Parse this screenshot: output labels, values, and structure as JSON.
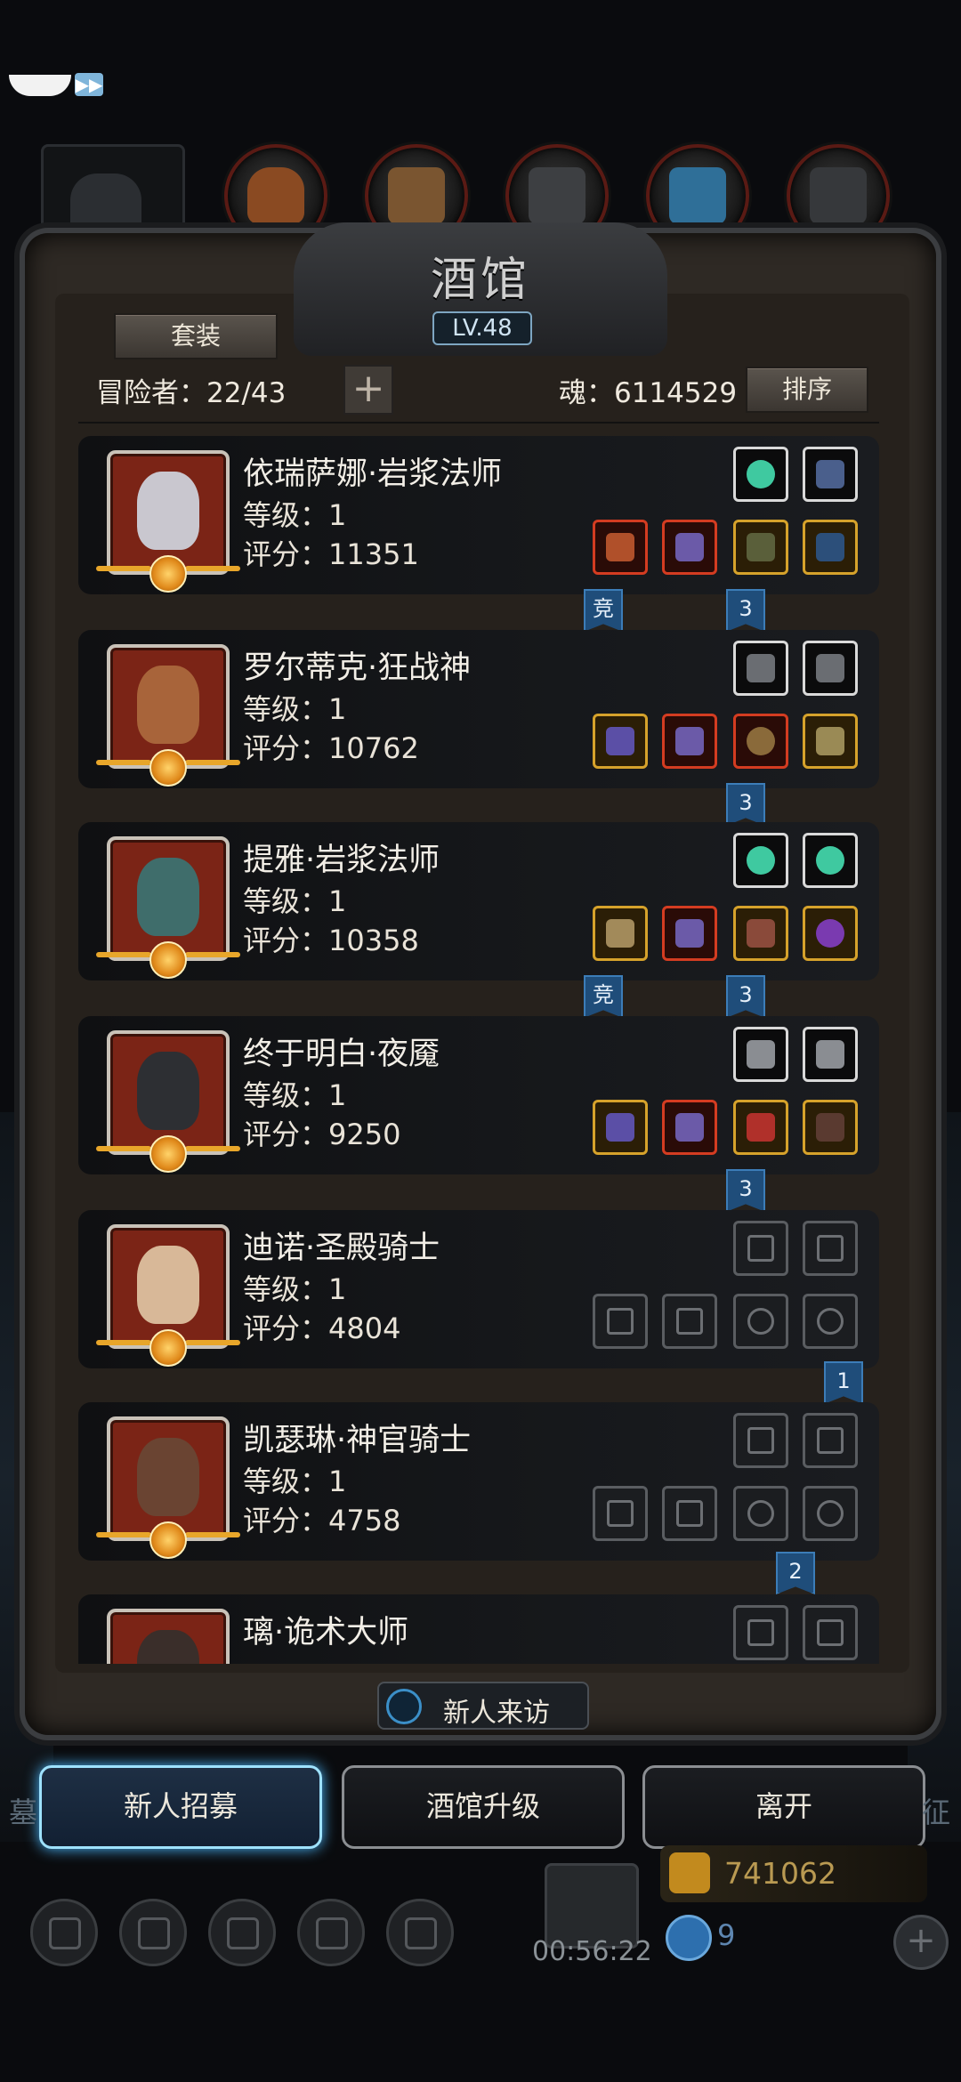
{
  "window": {
    "title": "酒馆",
    "level": "LV.48"
  },
  "header": {
    "suit_button": "套装",
    "adventurers_label": "冒险者：22/43",
    "plus_symbol": "+",
    "soul_label": "魂：6114529",
    "sort_button": "排序"
  },
  "top_tabs": [
    "hero-tab",
    "leather-tab",
    "wood-tab",
    "iron-tab",
    "crystal-tab",
    "steel-tab"
  ],
  "heroes": [
    {
      "name": "依瑞萨娜·岩浆法师",
      "level": "等级：1",
      "score": "评分：11351",
      "badges": [
        "竞",
        "3"
      ]
    },
    {
      "name": "罗尔蒂克·狂战神",
      "level": "等级：1",
      "score": "评分：10762",
      "badges": [
        "3"
      ]
    },
    {
      "name": "提雅·岩浆法师",
      "level": "等级：1",
      "score": "评分：10358",
      "badges": [
        "竞",
        "3"
      ]
    },
    {
      "name": "终于明白·夜魇",
      "level": "等级：1",
      "score": "评分：9250",
      "badges": [
        "3"
      ]
    },
    {
      "name": "迪诺·圣殿骑士",
      "level": "等级：1",
      "score": "评分：4804",
      "badges": [
        "1"
      ]
    },
    {
      "name": "凯瑟琳·神官骑士",
      "level": "等级：1",
      "score": "评分：4758",
      "badges": [
        "2"
      ]
    },
    {
      "name": "璃·诡术大师",
      "level": "",
      "score": "",
      "badges": []
    }
  ],
  "footer": {
    "visit_label": "新人来访",
    "recruit_button": "新人招募",
    "upgrade_button": "酒馆升级",
    "leave_button": "离开",
    "side_left": "墓",
    "side_right": "征",
    "timer": "00:56:22",
    "gold": "741062",
    "gems": "9",
    "add_symbol": "+"
  },
  "speed_symbol": "▶▶",
  "colors": {
    "accent_blue": "#3c7db8",
    "gold_border": "#d6a22b",
    "red_border": "#d43c21"
  }
}
